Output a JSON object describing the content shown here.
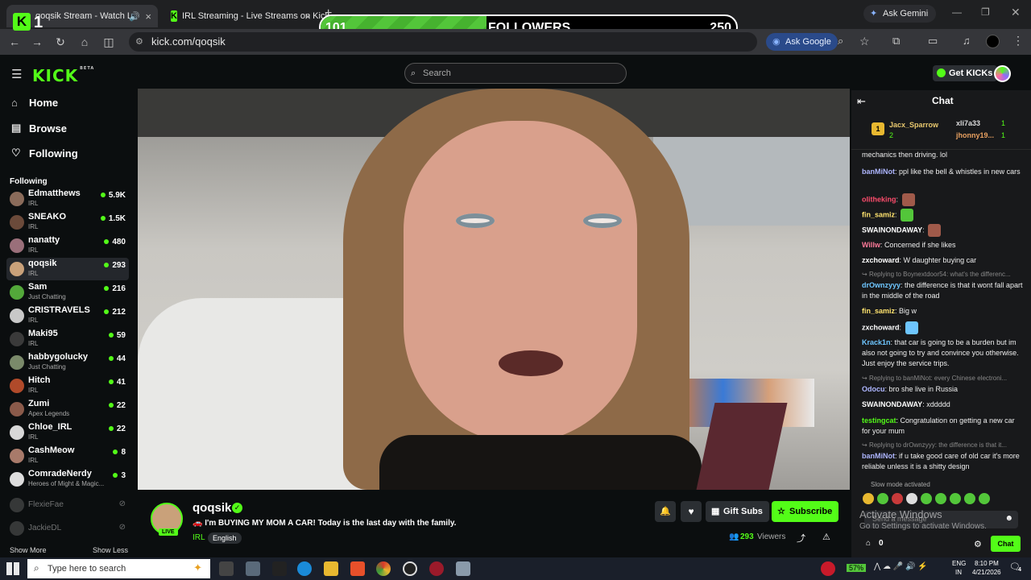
{
  "browser": {
    "tabs": [
      {
        "title": "qoqsik Stream - Watch Live on Kick"
      },
      {
        "title": "IRL Streaming - Live Streams on Kick"
      }
    ],
    "tab_number": "1",
    "url": "kick.com/qoqsik",
    "ask_gemini": "Ask Gemini",
    "ask_google": "Ask Google"
  },
  "follower_goal": {
    "current": "101",
    "label": "FOLLOWERS",
    "target": "250",
    "progress": 0.4
  },
  "header": {
    "logo": "KICK",
    "beta": "BETA",
    "search_placeholder": "Search",
    "get_kicks": "Get KICKs"
  },
  "sidebar": {
    "nav": [
      {
        "label": "Home"
      },
      {
        "label": "Browse"
      },
      {
        "label": "Following"
      }
    ],
    "following_title": "Following",
    "channels": [
      {
        "name": "Edmatthews",
        "category": "IRL",
        "viewers": "5.9K",
        "color": "#8a6b5a"
      },
      {
        "name": "SNEAKO",
        "category": "IRL",
        "viewers": "1.5K",
        "color": "#6b4a3a"
      },
      {
        "name": "nanatty",
        "category": "IRL",
        "viewers": "480",
        "color": "#9a6f7a"
      },
      {
        "name": "qoqsik",
        "category": "IRL",
        "viewers": "293",
        "color": "#c9a17a"
      },
      {
        "name": "Sam",
        "category": "Just Chatting",
        "viewers": "216",
        "color": "#53a83a"
      },
      {
        "name": "CRISTRAVELS",
        "category": "IRL",
        "viewers": "212",
        "color": "#c8c8c8"
      },
      {
        "name": "Maki95",
        "category": "IRL",
        "viewers": "59",
        "color": "#3a3a3a"
      },
      {
        "name": "habbygolucky",
        "category": "Just Chatting",
        "viewers": "44",
        "color": "#7a8a6a"
      },
      {
        "name": "Hitch",
        "category": "IRL",
        "viewers": "41",
        "color": "#b04a2a"
      },
      {
        "name": "Zumi",
        "category": "Apex Legends",
        "viewers": "22",
        "color": "#8a5a4a"
      },
      {
        "name": "Chloe_IRL",
        "category": "IRL",
        "viewers": "22",
        "color": "#d8d8d8"
      },
      {
        "name": "CashMeow",
        "category": "IRL",
        "viewers": "8",
        "color": "#a87a6a"
      },
      {
        "name": "ComradeNerdy",
        "category": "Heroes of Might & Magic...",
        "viewers": "3",
        "color": "#dddddd"
      }
    ],
    "offline": [
      {
        "name": "FlexieFae"
      },
      {
        "name": "JackieDL"
      }
    ],
    "show_more": "Show More",
    "show_less": "Show Less"
  },
  "stream": {
    "channel": "qoqsik",
    "live_badge": "LIVE",
    "title": "🚗 I'm BUYING MY MOM A CAR! Today is the last day with the family.",
    "category": "IRL",
    "language": "English",
    "viewers_count": "293",
    "viewers_label": "Viewers",
    "gift_subs": "Gift Subs",
    "subscribe": "Subscribe"
  },
  "chat": {
    "title": "Chat",
    "leaderboard": [
      {
        "rank": "1",
        "name": "Jacx_Sparrow",
        "count": "2"
      },
      {
        "name": "xli7a33",
        "count": "1"
      },
      {
        "name": "jhonny19...",
        "count": "1"
      }
    ],
    "messages": [
      {
        "user": "",
        "text": "mechanics then driving. lol",
        "color": "#ffffff"
      },
      {
        "user": "banMiNot",
        "text": "ppl like the bell & whistles in new cars",
        "color": "#aeb6ff"
      },
      {
        "user": "olitheking",
        "text": "",
        "color": "#ff4d6d"
      },
      {
        "user": "fin_samiz",
        "text": "",
        "color": "#ffe36e"
      },
      {
        "user": "SWAINONDAWAY",
        "text": "",
        "color": "#ffffff"
      },
      {
        "user": "Willw",
        "text": "Concerned if she likes",
        "color": "#ff7a9a"
      },
      {
        "user": "zxchoward",
        "text": "W daughter buying car",
        "color": "#ffffff"
      },
      {
        "user": "drOwnzyyy",
        "text": "the difference is that it wont fall apart in the middle of the road",
        "color": "#6ec6ff",
        "reply": "Replying to Boynextdoor54: what's the differenc..."
      },
      {
        "user": "fin_samiz",
        "text": "Big w",
        "color": "#ffe36e"
      },
      {
        "user": "zxchoward",
        "text": "",
        "color": "#ffffff"
      },
      {
        "user": "Krack1n",
        "text": "that car is going to be a burden but im also not going to try and convince you otherwise. Just enjoy the service trips.",
        "color": "#6ec6ff"
      },
      {
        "user": "Odocu",
        "text": "bro she live in Russia",
        "color": "#aeb6ff",
        "reply": "Replying to banMiNot: every Chinese electroni..."
      },
      {
        "user": "SWAINONDAWAY",
        "text": "xddddd",
        "color": "#ffffff"
      },
      {
        "user": "testingcat",
        "text": "Congratulation on getting a new car for your mum",
        "color": "#53fc18"
      },
      {
        "user": "banMiNot",
        "text": "if u take good care of old car it's more reliable unless it is a shitty design",
        "color": "#aeb6ff",
        "reply": "Replying to drOwnzyyy: the difference is that it..."
      }
    ],
    "slow_mode": "Slow mode activated",
    "input_placeholder": "Send a message",
    "points": "0",
    "send_label": "Chat",
    "activate_title": "Activate Windows",
    "activate_sub": "Go to Settings to activate Windows."
  },
  "taskbar": {
    "search_placeholder": "Type here to search",
    "battery": "57%",
    "lang": "ENG",
    "region": "IN",
    "time": "8:10 PM",
    "date": "4/21/2026",
    "notifications": "4"
  }
}
